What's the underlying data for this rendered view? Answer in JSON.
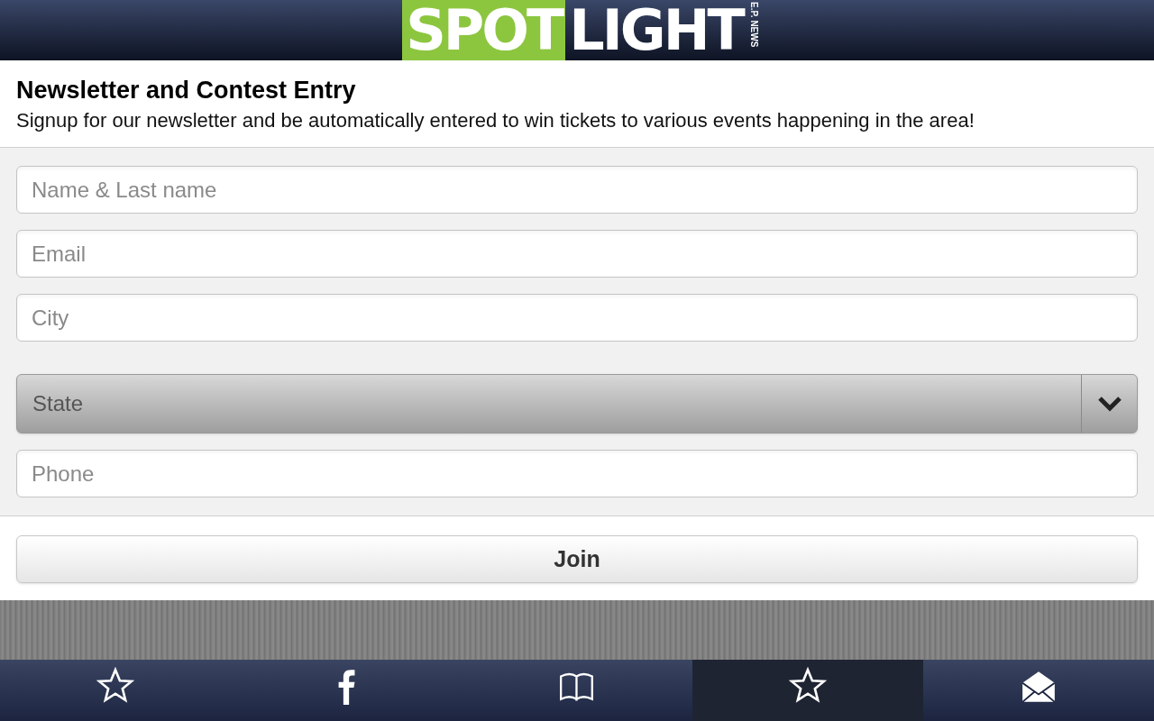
{
  "logo": {
    "highlight": "SPOT",
    "rest": "LIGHT",
    "side": "E.P. NEWS"
  },
  "intro": {
    "title": "Newsletter and Contest Entry",
    "text": "Signup for our newsletter and be automatically entered to win tickets to various events happening in the area!"
  },
  "fields": [
    {
      "kind": "text",
      "placeholder": "Name & Last name"
    },
    {
      "kind": "text",
      "placeholder": "Email"
    },
    {
      "kind": "text",
      "placeholder": "City"
    },
    {
      "kind": "select",
      "placeholder": "State"
    },
    {
      "kind": "text",
      "placeholder": "Phone"
    }
  ],
  "submit": "Join",
  "tabs": [
    {
      "kind": "star",
      "selected": false
    },
    {
      "kind": "facebook",
      "selected": false
    },
    {
      "kind": "book",
      "selected": false
    },
    {
      "kind": "star",
      "selected": true
    },
    {
      "kind": "envelope",
      "selected": false
    }
  ]
}
